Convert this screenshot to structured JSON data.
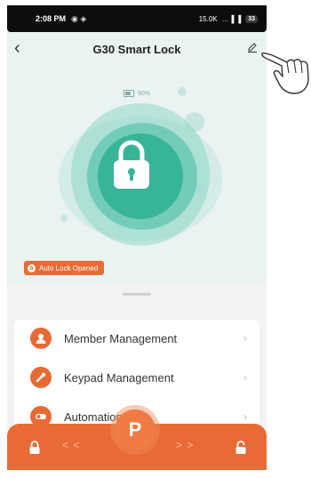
{
  "status_bar": {
    "time": "2:08 PM",
    "icons": "◉ ◈",
    "network": "15.0K",
    "signal": "…▐ ▐",
    "battery": "33"
  },
  "header": {
    "title": "G30 Smart Lock",
    "back_icon": "back-chevron-icon",
    "edit_icon": "edit-pencil-icon"
  },
  "device": {
    "battery": "90%"
  },
  "badge": {
    "icon": "a",
    "text": "Auto Lock Opened"
  },
  "menu": [
    {
      "label": "Member Management",
      "icon": "member-icon"
    },
    {
      "label": "Keypad Management",
      "icon": "keypad-icon"
    },
    {
      "label": "Automation",
      "icon": "automation-icon"
    }
  ],
  "bottom_bar": {
    "center_label": "P",
    "left_arrows": "< <",
    "right_arrows": "> >"
  },
  "colors": {
    "accent": "#e86a35",
    "lock_green": "#2fae96",
    "background": "#eaf3f2"
  }
}
